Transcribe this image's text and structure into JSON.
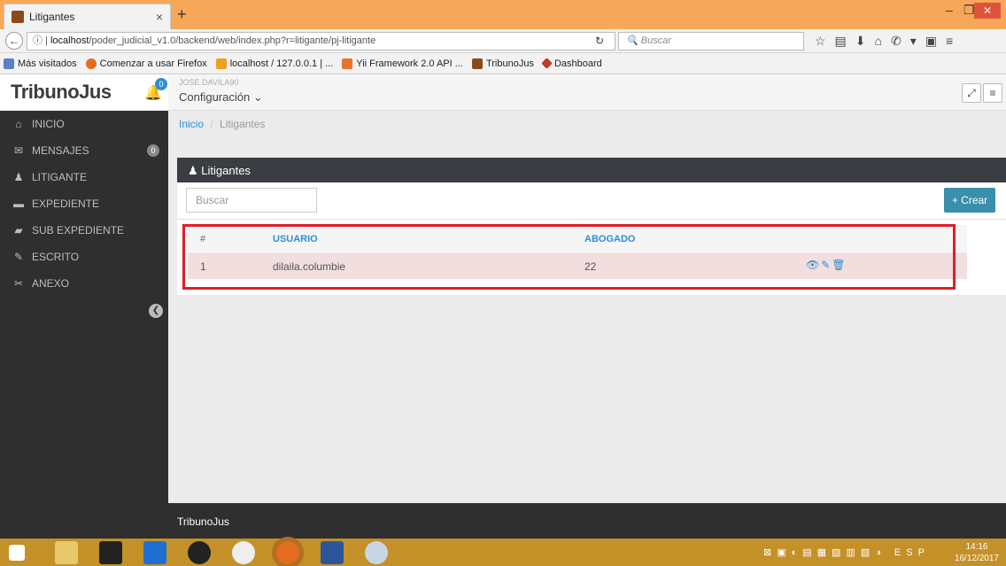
{
  "browser": {
    "tab_title": "Litigantes",
    "tab_close": "×",
    "new_tab": "+",
    "url_host": "localhost",
    "url_path": "/poder_judicial_v1.0/backend/web/index.php?r=litigante/pj-litigante",
    "search_placeholder": "Buscar",
    "bookmarks": [
      "Más visitados",
      "Comenzar a usar Firefox",
      "localhost / 127.0.0.1 | ...",
      "Yii Framework 2.0 API ...",
      "TribunoJus",
      "Dashboard"
    ]
  },
  "app": {
    "brand": "TribunoJus",
    "bell_count": "0",
    "user": "JOSE.DAVILA90",
    "config_label": "Configuración ⌄"
  },
  "sidebar": {
    "items": [
      {
        "label": "INICIO",
        "icon": "home-icon"
      },
      {
        "label": "MENSAJES",
        "icon": "envelope-icon",
        "badge": "0"
      },
      {
        "label": "LITIGANTE",
        "icon": "user-icon"
      },
      {
        "label": "EXPEDIENTE",
        "icon": "folder-icon"
      },
      {
        "label": "SUB EXPEDIENTE",
        "icon": "folder-open-icon"
      },
      {
        "label": "ESCRITO",
        "icon": "edit-icon"
      },
      {
        "label": "ANEXO",
        "icon": "paperclip-icon"
      }
    ]
  },
  "breadcrumb": {
    "home": "Inicio",
    "sep": "/",
    "current": "Litigantes"
  },
  "panel": {
    "title": "Litigantes",
    "search_placeholder": "Buscar",
    "create_label": "+ Crear"
  },
  "table": {
    "headers": [
      "#",
      "USUARIO",
      "ABOGADO"
    ],
    "rows": [
      {
        "num": "1",
        "usuario": "dilaila.columbie",
        "abogado": "22"
      }
    ]
  },
  "footer": {
    "text": "TribunoJus"
  },
  "taskbar": {
    "lang": "ESP",
    "time": "14:16",
    "date": "16/12/2017"
  }
}
